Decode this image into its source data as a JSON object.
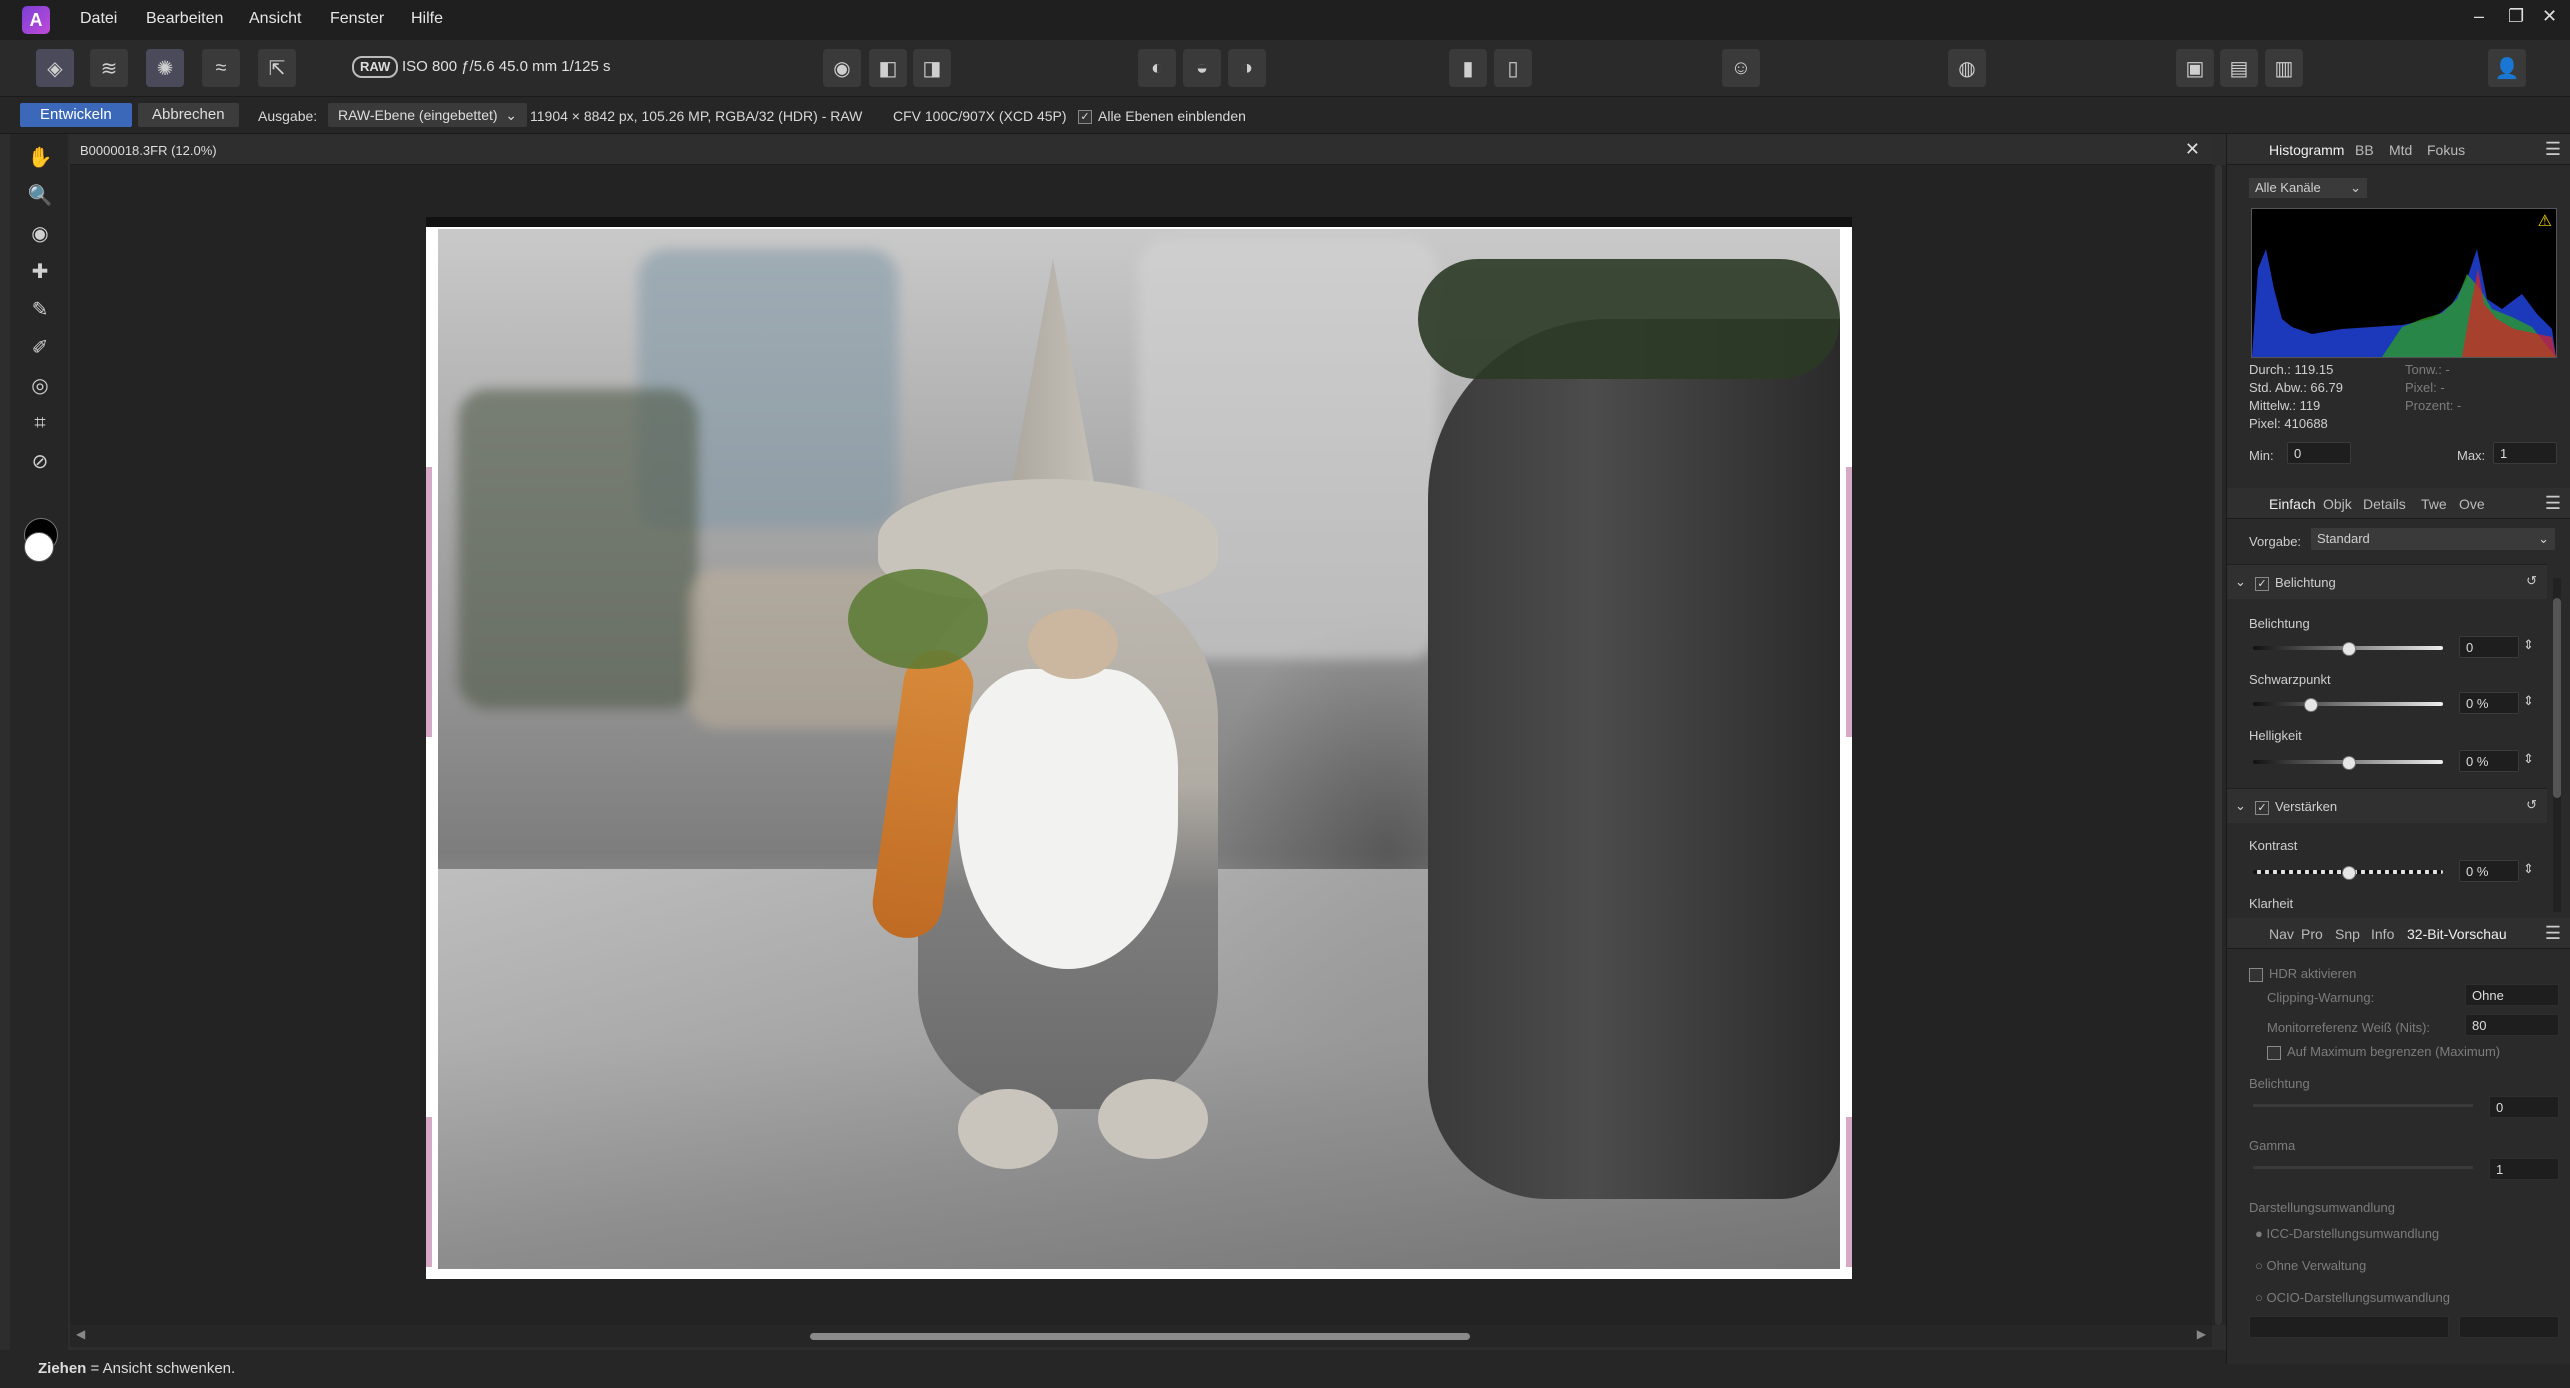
{
  "menubar": {
    "items": [
      "Datei",
      "Bearbeiten",
      "Ansicht",
      "Fenster",
      "Hilfe"
    ]
  },
  "toolbar": {
    "raw_badge": "RAW",
    "exif": "ISO 800 ƒ/5.6 45.0 mm 1/125 s"
  },
  "contextbar": {
    "develop": "Entwickeln",
    "cancel": "Abbrechen",
    "output_label": "Ausgabe:",
    "output_value": "RAW-Ebene (eingebettet)",
    "image_info": "11904 × 8842 px, 105.26 MP, RGBA/32 (HDR) - RAW",
    "camera": "CFV 100C/907X (XCD 45P)",
    "show_all_layers": "Alle Ebenen einblenden"
  },
  "document": {
    "title": "B0000018.3FR (12.0%)"
  },
  "status": {
    "action": "Ziehen",
    "description": "= Ansicht schwenken."
  },
  "histogram_panel": {
    "tabs": [
      "Histogramm",
      "BB",
      "Mtd",
      "Fokus"
    ],
    "channel": "Alle Kanäle",
    "stats": {
      "mean": "Durch.: 119.15",
      "std": "Std. Abw.: 66.79",
      "median": "Mittelw.: 119",
      "pixels": "Pixel: 410688",
      "tone": "Tonw.: -",
      "pixel2": "Pixel: -",
      "percent": "Prozent: -"
    },
    "min_label": "Min:",
    "min_value": "0",
    "max_label": "Max:",
    "max_value": "1"
  },
  "develop_panel": {
    "tabs": [
      "Einfach",
      "Objk",
      "Details",
      "Twe",
      "Ove"
    ],
    "preset_label": "Vorgabe:",
    "preset_value": "Standard",
    "exposure_section": "Belichtung",
    "exposure_label": "Belichtung",
    "exposure_value": "0",
    "blackpoint_label": "Schwarzpunkt",
    "blackpoint_value": "0 %",
    "brightness_label": "Helligkeit",
    "brightness_value": "0 %",
    "enhance_section": "Verstärken",
    "contrast_label": "Kontrast",
    "contrast_value": "0 %",
    "clarity_label": "Klarheit",
    "exposure_level": 0.5,
    "blackpoint_level": 0.3,
    "brightness_level": 0.5,
    "contrast_level": 0.5
  },
  "preview_panel": {
    "tabs": [
      "Nav",
      "Pro",
      "Snp",
      "Info",
      "32-Bit-Vorschau"
    ],
    "hdr_enable": "HDR aktivieren",
    "clipping_label": "Clipping-Warnung:",
    "clipping_value": "Ohne",
    "monitor_label": "Monitorreferenz Weiß (Nits):",
    "monitor_value": "80",
    "limit_max": "Auf Maximum begrenzen (Maximum)",
    "exposure_label": "Belichtung",
    "exposure_value": "0",
    "gamma_label": "Gamma",
    "gamma_value": "1",
    "transform_label": "Darstellungsumwandlung",
    "opt_icc": "ICC-Darstellungsumwandlung",
    "opt_none": "Ohne Verwaltung",
    "opt_ocio": "OCIO-Darstellungsumwandlung"
  },
  "colors": {
    "accent": "#3b68b8",
    "background": "#2d2d2d",
    "panel": "#2a2a2a"
  }
}
